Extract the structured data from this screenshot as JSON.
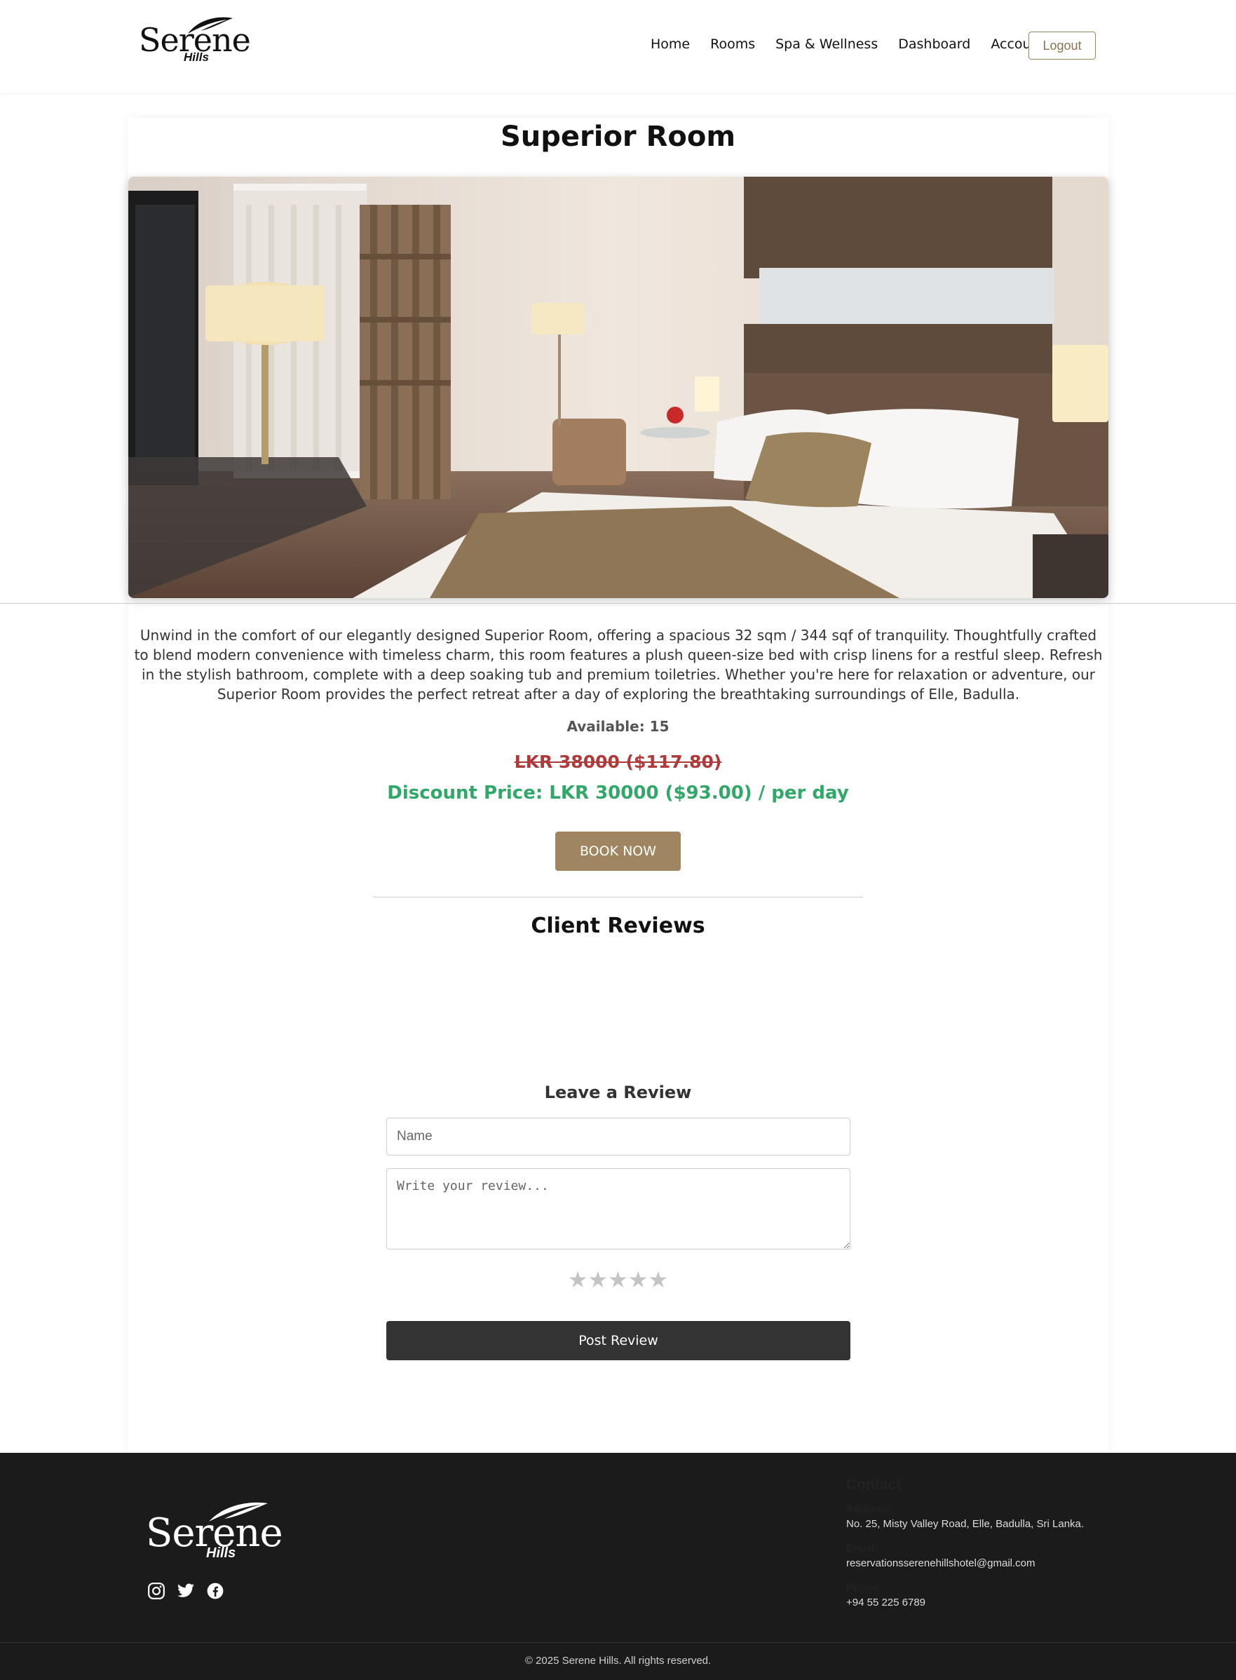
{
  "header": {
    "logo_word": "Serene",
    "logo_sub": "Hills",
    "nav": [
      "Home",
      "Rooms",
      "Spa & Wellness",
      "Dashboard",
      "Account"
    ],
    "logout_label": "Logout"
  },
  "room": {
    "title": "Superior Room",
    "description": "Unwind in the comfort of our elegantly designed Superior Room, offering a spacious 32 sqm / 344 sqf of tranquility. Thoughtfully crafted to blend modern convenience with timeless charm, this room features a plush queen-size bed with crisp linens for a restful sleep. Refresh in the stylish bathroom, complete with a deep soaking tub and premium toiletries. Whether you're here for relaxation or adventure, our Superior Room provides the perfect retreat after a day of exploring the breathtaking surroundings of Elle, Badulla.",
    "available": "Available: 15",
    "old_price": "LKR 38000 ($117.80)",
    "discount_price": "Discount Price: LKR 30000 ($93.00) / per day",
    "book_label": "BOOK NOW"
  },
  "reviews": {
    "title": "Client Reviews",
    "leave_title": "Leave a Review",
    "name_placeholder": "Name",
    "review_placeholder": "Write your review...",
    "stars": [
      "★",
      "★",
      "★",
      "★",
      "★"
    ],
    "post_label": "Post Review"
  },
  "footer": {
    "logo_word": "Serene",
    "logo_sub": "Hills",
    "contact_title": "Contact",
    "address_label": "Address:",
    "address": "No. 25, Misty Valley Road, Elle, Badulla, Sri Lanka.",
    "email_label": "Email:",
    "email": "reservationsserenehillshotel@gmail.com",
    "phone_label": "Phone:",
    "phone": "+94 55 225 6789",
    "copyright": "© 2025 Serene Hills. All rights reserved.",
    "social_icons": [
      "instagram-icon",
      "twitter-icon",
      "facebook-icon"
    ]
  },
  "colors": {
    "accent": "#a08660",
    "old_price": "#b03a3a",
    "discount": "#2fa868",
    "footer_bg": "#1b1b1b",
    "post_button": "#333333"
  }
}
